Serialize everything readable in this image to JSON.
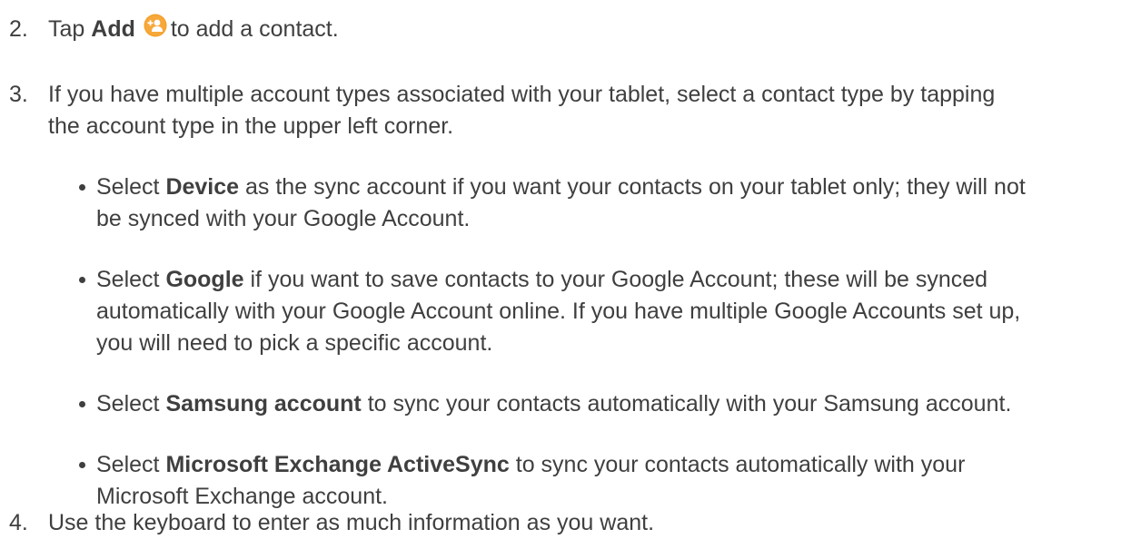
{
  "steps": [
    {
      "num": "2.",
      "pre": "Tap",
      "bold": "Add",
      "post": "to add a contact.",
      "icon": "add-contact-icon",
      "icon_color": "#f39c1e"
    },
    {
      "num": "3.",
      "line1": "If you have multiple account types associated with your tablet, select a contact type by tapping",
      "line2": "the account type in the upper left corner."
    },
    {
      "num": "4.",
      "text": "Use the keyboard to enter as much information as you want."
    }
  ],
  "bullets": [
    {
      "pre": "Select",
      "bold": "Device",
      "line1_post": "as the sync account if you want your contacts on your tablet only; they will not",
      "line2": "be synced with your Google Account."
    },
    {
      "pre": "Select",
      "bold": "Google",
      "line1_post": "if you want to save contacts to your Google Account; these will be synced",
      "line2": "automatically with your Google Account online. If you have multiple Google Accounts set up,",
      "line3": "you will need to pick a specific account."
    },
    {
      "pre": "Select",
      "bold": "Samsung account",
      "line1_post": "to sync your contacts automatically with your Samsung account."
    },
    {
      "pre": "Select",
      "bold": "Microsoft Exchange ActiveSync",
      "line1_post": "to sync your contacts automatically with your",
      "line2": "Microsoft Exchange account."
    }
  ]
}
